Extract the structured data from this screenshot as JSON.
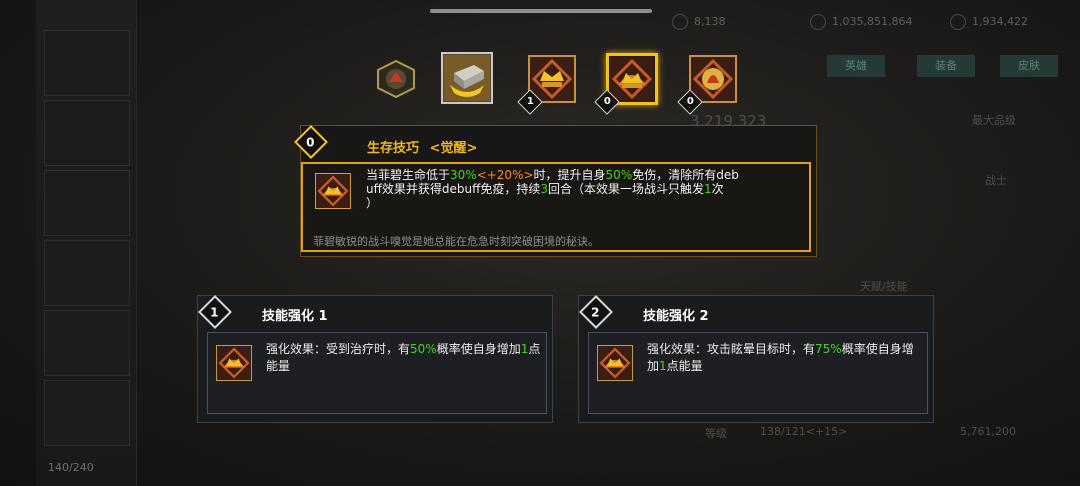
{
  "background": {
    "resources": [
      {
        "icon": "energy-icon",
        "value": "8,138"
      },
      {
        "icon": "credit-icon",
        "value": "1,035,851,864"
      },
      {
        "icon": "gem-icon",
        "value": "1,934,422"
      }
    ],
    "tabs": [
      "英雄",
      "装备",
      "皮肤"
    ],
    "power": "3,219,323",
    "stat_label": "最大品级",
    "role_label": "战士",
    "section_label": "天赋/技能",
    "level_label": "等级",
    "level_value": "138/121<+15>",
    "bottom_currency": "5,761,200",
    "inventory_count": "140/240"
  },
  "skills": [
    {
      "name": "hero-portrait-icon",
      "level": ""
    },
    {
      "name": "armor-block-skill-icon",
      "level": ""
    },
    {
      "name": "crown-skill-icon",
      "level": "1"
    },
    {
      "name": "survival-skill-icon",
      "level": "0",
      "selected": true
    },
    {
      "name": "fire-crest-skill-icon",
      "level": "0"
    }
  ],
  "tooltip": {
    "level": "0",
    "title": "生存技巧",
    "tag": "<觉醒>",
    "desc_1": "当菲碧生命低于",
    "desc_2": "30%",
    "desc_3": "<+20%>",
    "desc_4": "时，提升自身",
    "desc_5": "50%",
    "desc_6": "免伤，清除所有deb",
    "desc_7": "uff效果并获得debuff免疫，持续",
    "desc_8": "3",
    "desc_9": "回合（本效果一场战斗只触发",
    "desc_10": "1",
    "desc_11": "次",
    "desc_12": "）",
    "flavor": "菲碧敏锐的战斗嗅觉是她总能在危急时刻突破困境的秘诀。"
  },
  "upgrades": [
    {
      "number": "1",
      "title": "技能强化 1",
      "d1": "强化效果：受到治疗时，有",
      "d2": "50%",
      "d3": "概率使自身增加",
      "d4": "1",
      "d5": "点能量"
    },
    {
      "number": "2",
      "title": "技能强化 2",
      "d1": "强化效果：攻击眩晕目标时，有",
      "d2": "75%",
      "d3": "概率使自身增加",
      "d4": "1",
      "d5": "点能量"
    }
  ],
  "colors": {
    "accent_gold": "#e0a21a",
    "highlight_green": "#46d31f",
    "highlight_orange": "#ff8a2a"
  }
}
